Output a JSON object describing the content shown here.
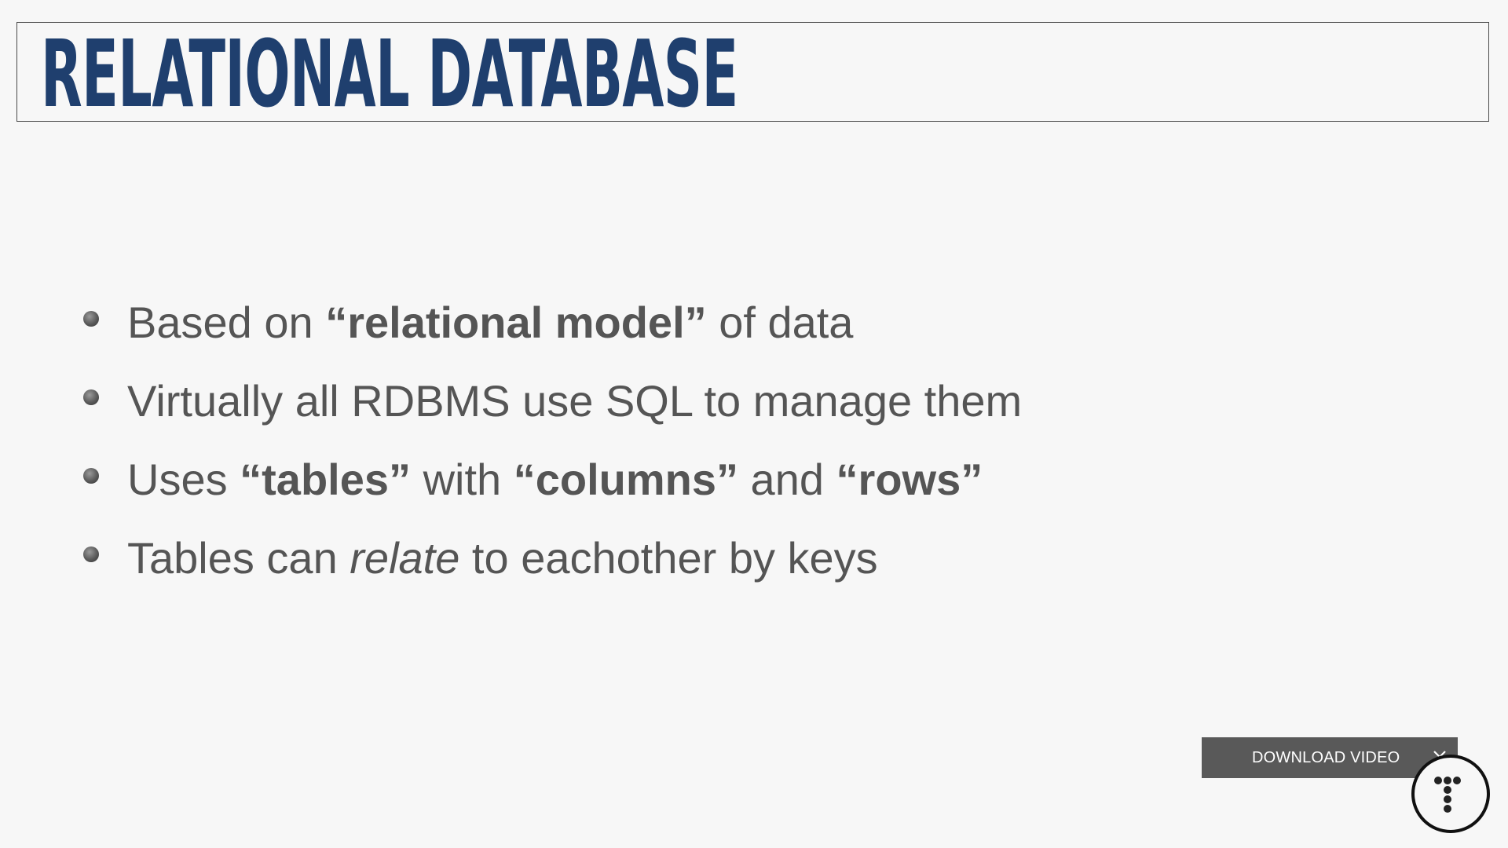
{
  "slide": {
    "title": "RELATIONAL DATABASE",
    "bullets": [
      {
        "segments": [
          {
            "text": "Based on ",
            "style": "normal"
          },
          {
            "text": "“relational model”",
            "style": "bold"
          },
          {
            "text": " of data",
            "style": "normal"
          }
        ]
      },
      {
        "segments": [
          {
            "text": "Virtually all RDBMS use SQL to manage them",
            "style": "normal"
          }
        ]
      },
      {
        "segments": [
          {
            "text": "Uses ",
            "style": "normal"
          },
          {
            "text": "“tables”",
            "style": "bold"
          },
          {
            "text": " with ",
            "style": "normal"
          },
          {
            "text": "“columns”",
            "style": "bold"
          },
          {
            "text": " and ",
            "style": "normal"
          },
          {
            "text": "“rows”",
            "style": "bold"
          }
        ]
      },
      {
        "segments": [
          {
            "text": "Tables can ",
            "style": "normal"
          },
          {
            "text": "relate",
            "style": "italic"
          },
          {
            "text": " to eachother by keys",
            "style": "normal"
          }
        ]
      }
    ]
  },
  "overlay": {
    "download_label": "DOWNLOAD VIDEO",
    "close_icon": "close-icon",
    "logo_icon": "brand-logo-icon"
  },
  "colors": {
    "title": "#1f3f6e",
    "body_text": "#555555",
    "background": "#f7f7f7",
    "download_bar": "#595959"
  }
}
